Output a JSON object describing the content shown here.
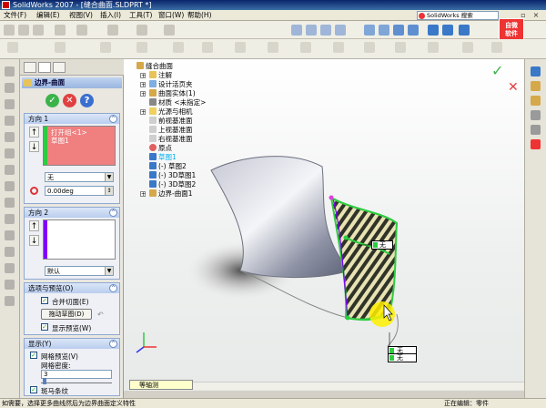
{
  "window": {
    "title": "SolidWorks 2007 - [缝合曲面.SLDPRT *]"
  },
  "menu": [
    "文件(F)",
    "编辑(E)",
    "视图(V)",
    "插入(I)",
    "工具(T)",
    "窗口(W)",
    "帮助(H)"
  ],
  "search": {
    "placeholder": "SolidWorks 搜索"
  },
  "logo": {
    "line1": "自微",
    "line2": "软件"
  },
  "commands": [
    "特征",
    "草图",
    "曲面",
    "钣金",
    "模具",
    "焊件",
    "评估",
    "显示",
    "装配",
    "线路"
  ],
  "panel": {
    "title": "边界-曲面",
    "direction1": {
      "header": "方向 1",
      "items": [
        "打开组<1>",
        "草图1"
      ],
      "tangency": "无",
      "draft_angle": "0.00deg"
    },
    "direction2": {
      "header": "方向 2",
      "tangency": "默认"
    },
    "options": {
      "header": "选项与预览(O)",
      "merge_label": "合并切面(E)",
      "drag_sketch": "拖动草图(D)",
      "preview_label": "显示预览(W)"
    },
    "display": {
      "header": "显示(Y)",
      "mesh_preview": "网格预览(V)",
      "mesh_density_label": "网格密度:",
      "mesh_density": "3",
      "zebra_label": "斑马条纹"
    }
  },
  "tree": {
    "root": "缝合曲面",
    "items": [
      "注解",
      "设计活页夹",
      "曲面实体(1)",
      "材质 <未指定>",
      "光源与相机",
      "前视基准面",
      "上视基准面",
      "右视基准面",
      "原点",
      "草图1",
      "(-) 草图2",
      "(-) 3D草图1",
      "(-) 3D草图2",
      "边界-曲面1"
    ]
  },
  "callouts": {
    "top": "无",
    "bottom1": "无",
    "bottom2": "无"
  },
  "viewport": {
    "view_label": "等轴测"
  },
  "status": {
    "left": "如需要，选择更多曲线然后为边界曲面定义特性",
    "right": "正在编辑：零件"
  },
  "colors": {
    "accent": "#f08080",
    "series2": "#8000ff",
    "green": "#2ecc40"
  }
}
